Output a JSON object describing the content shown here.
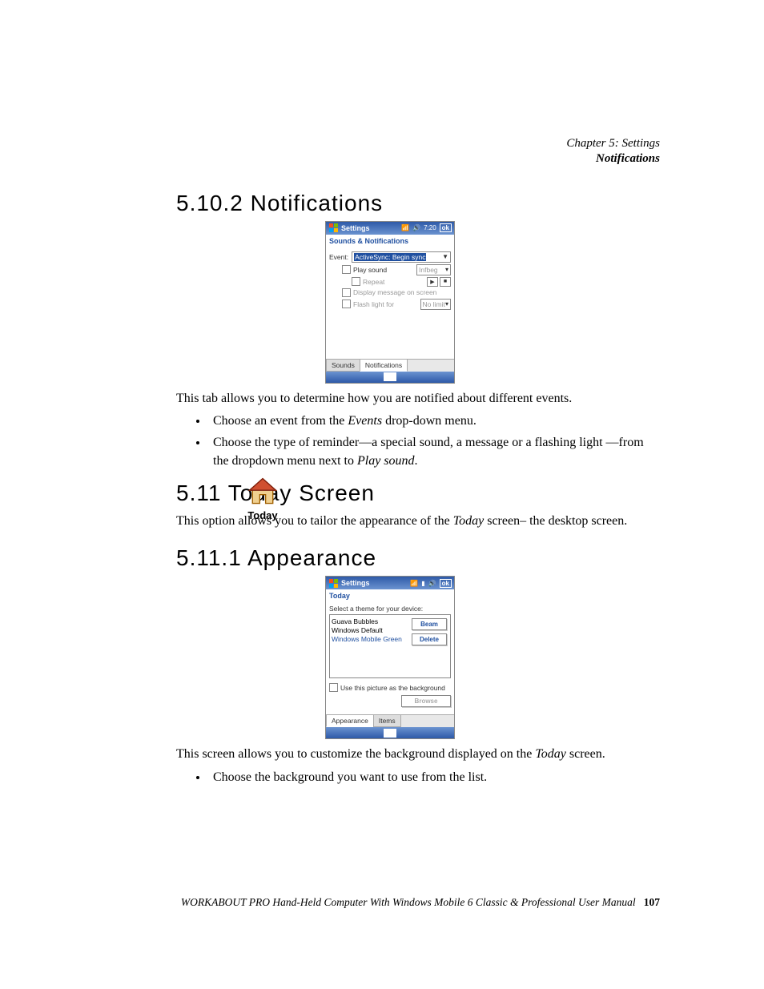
{
  "header": {
    "chapter": "Chapter 5: Settings",
    "topic": "Notifications"
  },
  "sec_5_10_2": {
    "heading": "5.10.2 Notifications",
    "body": "This tab allows you to determine how you are notified about different events.",
    "bullet1_pre": "Choose an event from the ",
    "bullet1_ital": "Events",
    "bullet1_post": " drop-down menu.",
    "bullet2_pre": "Choose the type of reminder—a special sound, a message or a flashing light —from the dropdown menu next to ",
    "bullet2_ital": "Play sound",
    "bullet2_post": "."
  },
  "shot1": {
    "title": "Settings",
    "time": "7:20",
    "ok": "ok",
    "subheader": "Sounds & Notifications",
    "event_label": "Event:",
    "event_value": "ActiveSync: Begin sync",
    "play_sound": "Play sound",
    "repeat": "Repeat",
    "snd_value": "Infbeg",
    "display_msg": "Display message on screen",
    "flash_light": "Flash light for",
    "flash_value": "No limit",
    "tab_sounds": "Sounds",
    "tab_notifications": "Notifications"
  },
  "sec_5_11": {
    "heading": "5.11 Today Screen",
    "body_pre": "This option allows you to tailor the appearance of the ",
    "body_ital": "Today",
    "body_post": " screen– the desktop screen.",
    "icon_caption": "Today"
  },
  "sec_5_11_1": {
    "heading": "5.11.1 Appearance",
    "body_pre": "This screen allows you to customize the background displayed on the ",
    "body_ital": "Today",
    "body_post": " screen.",
    "bullet1": "Choose the background you want to use from the list."
  },
  "shot2": {
    "title": "Settings",
    "ok": "ok",
    "subheader": "Today",
    "prompt": "Select a theme for your device:",
    "items": [
      "Guava Bubbles",
      "Windows Default",
      "Windows Mobile Green"
    ],
    "beam": "Beam",
    "delete": "Delete",
    "use_pic": "Use this picture as the background",
    "browse": "Browse",
    "tab_appearance": "Appearance",
    "tab_items": "Items"
  },
  "footer": {
    "text": "WORKABOUT PRO Hand-Held Computer With Windows Mobile 6 Classic & Professional User Manual",
    "page": "107"
  }
}
